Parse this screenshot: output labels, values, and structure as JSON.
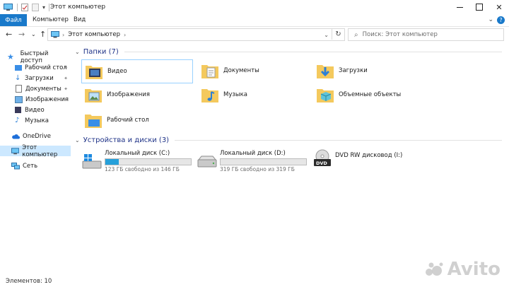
{
  "window": {
    "title": "Этот компьютер",
    "controls": [
      "minimize-icon",
      "maximize-icon",
      "close-icon"
    ]
  },
  "ribbon": {
    "tabs": [
      {
        "label": "Файл",
        "active": true
      },
      {
        "label": "Компьютер"
      },
      {
        "label": "Вид"
      }
    ],
    "accent": "#1979ca"
  },
  "address": {
    "path": "Этот компьютер",
    "search_placeholder": "Поиск: Этот компьютер"
  },
  "sidebar": {
    "items": [
      {
        "label": "Быстрый доступ",
        "icon": "star-icon"
      },
      {
        "label": "Рабочий стол",
        "icon": "desktop-icon",
        "pinned": true
      },
      {
        "label": "Загрузки",
        "icon": "download-icon",
        "pinned": true
      },
      {
        "label": "Документы",
        "icon": "documents-icon",
        "pinned": true
      },
      {
        "label": "Изображения",
        "icon": "pictures-icon",
        "pinned": true
      },
      {
        "label": "Видео",
        "icon": "video-icon"
      },
      {
        "label": "Музыка",
        "icon": "music-icon"
      },
      {
        "label": "OneDrive",
        "icon": "cloud-icon"
      },
      {
        "label": "Этот компьютер",
        "icon": "computer-icon",
        "selected": true
      },
      {
        "label": "Сеть",
        "icon": "network-icon"
      }
    ]
  },
  "folders": {
    "header": "Папки (7)",
    "items": [
      {
        "label": "Видео",
        "icon": "video-folder-icon",
        "selected": true
      },
      {
        "label": "Документы",
        "icon": "documents-folder-icon"
      },
      {
        "label": "Загрузки",
        "icon": "downloads-folder-icon"
      },
      {
        "label": "Изображения",
        "icon": "pictures-folder-icon"
      },
      {
        "label": "Музыка",
        "icon": "music-folder-icon"
      },
      {
        "label": "Объемные объекты",
        "icon": "3d-objects-folder-icon"
      },
      {
        "label": "Рабочий стол",
        "icon": "desktop-folder-icon"
      }
    ]
  },
  "devices": {
    "header": "Устройства и диски (3)",
    "items": [
      {
        "name": "Локальный диск (C:)",
        "space": "123 ГБ свободно из 146 ГБ",
        "used_fraction": 0.16,
        "icon": "windows-drive-icon"
      },
      {
        "name": "Локальный диск (D:)",
        "space": "319 ГБ свободно из 319 ГБ",
        "used_fraction": 0.0,
        "icon": "hard-drive-icon"
      },
      {
        "name": "DVD RW дисковод (I:)",
        "space": "",
        "icon": "dvd-drive-icon",
        "badge": "DVD"
      }
    ]
  },
  "status": {
    "items_count": "Элементов: 10"
  },
  "watermark": {
    "text": "Avito"
  }
}
